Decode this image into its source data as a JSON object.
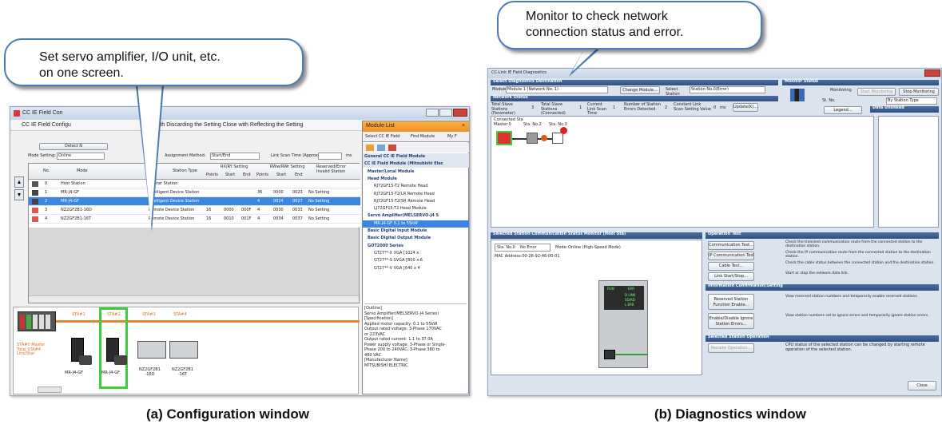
{
  "callouts": {
    "left": "Set servo amplifier, I/O unit, etc.\non one screen.",
    "right": "Monitor to check network\nconnection status and error."
  },
  "captions": {
    "a": "(a) Configuration window",
    "b": "(b) Diagnostics window"
  },
  "config_window": {
    "title": "CC IE Field Con",
    "menu": "CC IE Field Configu",
    "menu_rest": "e with Discarding the Setting   Close with Reflecting the Setting",
    "detect_button": "Detect N",
    "mode_setting_label": "Mode Setting:",
    "mode_setting_value": "Online",
    "assignment_method_label": "Assignment Method:",
    "assignment_method_value": "Start/End",
    "link_scan_label": "Link Scan Time (Approx.):",
    "link_scan_unit": "ms",
    "table_headers": [
      "No.",
      "Mode",
      "Station Type",
      "RX/RY Setting",
      "RWw/RWr Setting",
      "Reserved/Error Invalid Station"
    ],
    "subheaders": [
      "Points",
      "Start",
      "End",
      "Points",
      "Start",
      "End"
    ],
    "rows": [
      {
        "no": "0",
        "model": "Host Station",
        "type": "Master Station",
        "p1": "",
        "s1": "",
        "e1": "",
        "p2": "",
        "s2": "",
        "e2": "",
        "status": ""
      },
      {
        "no": "1",
        "model": "MR-J4-GF",
        "type": "Intelligent Device Station",
        "p1": "",
        "s1": "",
        "e1": "",
        "p2": "36",
        "s2": "0000",
        "e2": "0023",
        "status": "No Setting"
      },
      {
        "no": "2",
        "model": "MR-J4-GF",
        "type": "Intelligent Device Station",
        "p1": "",
        "s1": "",
        "e1": "",
        "p2": "4",
        "s2": "0024",
        "e2": "0027",
        "status": "No Setting"
      },
      {
        "no": "3",
        "model": "NZ2GF2B1-16D",
        "type": "Remote Device Station",
        "p1": "16",
        "s1": "0000",
        "e1": "000F",
        "p2": "4",
        "s2": "0030",
        "e2": "0033",
        "status": "No Setting"
      },
      {
        "no": "4",
        "model": "NZ2GF2B1-16T",
        "type": "Remote Device Station",
        "p1": "16",
        "s1": "0010",
        "e1": "001F",
        "p2": "4",
        "s2": "0034",
        "e2": "0037",
        "status": "No Setting"
      }
    ],
    "station_labels": [
      "STA#1",
      "STA#2",
      "STA#3",
      "STA#4"
    ],
    "master_label": "STA#0 Master\nTotal STA#4\nLine/Star",
    "device_labels": [
      "MR-J4-GF",
      "MR-J4-GF",
      "NZ2GF2B1\n-16D",
      "NZ2GF2B1\n-16T"
    ]
  },
  "module_list": {
    "title": "Module List",
    "tabs": [
      "Select CC IE Field",
      "Find Module",
      "My F"
    ],
    "items": [
      {
        "text": "General CC IE Field Module",
        "kind": "group"
      },
      {
        "text": "CC IE Field Module (Mitsubishi Elec",
        "kind": "group"
      },
      {
        "text": "Master/Local Module",
        "kind": "sub"
      },
      {
        "text": "Head Module",
        "kind": "sub"
      },
      {
        "text": "RJ72GF15-T2        Remote Head",
        "kind": "item"
      },
      {
        "text": "RJ72GF15-T2(LR Remote Head",
        "kind": "item"
      },
      {
        "text": "RJ72GF15-T2(SR Remote Head",
        "kind": "item"
      },
      {
        "text": "LJ72GF15-T2        Head Module",
        "kind": "item"
      },
      {
        "text": "Servo Amplifier(MELSERVO-J4 S",
        "kind": "sub"
      },
      {
        "text": "MR-J4-GF            0.1 to 55kW",
        "kind": "sel"
      },
      {
        "text": "Basic Digital Input Module",
        "kind": "sub"
      },
      {
        "text": "Basic Digital Output Module",
        "kind": "sub"
      },
      {
        "text": "GOT2000 Series",
        "kind": "sub"
      },
      {
        "text": "GT27**-X            XGA [1024 x",
        "kind": "item"
      },
      {
        "text": "GT27**-S            SVGA [800 x 6",
        "kind": "item"
      },
      {
        "text": "GT27**-V            VGA [640 x 4",
        "kind": "item"
      }
    ],
    "outline": "[Outline]\nServo Amplifier(MELSERVO-J4 Series)\n[Specification]\nApplied motor capacity: 0.1 to 55kW\nOutput rated voltage: 3-Phase 170VAC\nor 223VAC\nOutput rated current: 1.1 to 37.0A\nPower supply voltage: 3-Phase or Single-\nPhase 200 to 240VAC, 3-Phase 380 to\n480 VAC\n[Manufacturer Name]\nMITSUBISHI ELECTRIC"
  },
  "diag_window": {
    "title": "CC-Link IE Field Diagnostics",
    "select_dest": "Select Diagnostics Destination",
    "module_label": "Module",
    "module_value": "Module 1 (Network No. 1)",
    "change_module": "Change Module...",
    "select_station_label": "Select Station",
    "select_station_value": "Station No.0(Error)",
    "monitor_status": "Monitor Status",
    "monitoring": "Monitoring",
    "start_monitoring": "Start Monitoring",
    "stop_monitoring": "Stop Monitoring",
    "st_no": "St. No.",
    "by_station_type": "By Station Type",
    "network_status": "Network Status",
    "total_param": "Total Slave Stations (Parameter)",
    "total_param_val": "3",
    "total_conn": "Total Slave Stations (Connected)",
    "total_conn_val": "1",
    "current_scan": "Current Link Scan Time",
    "current_scan_val": "1",
    "num_errors": "Number of Station Errors Detected",
    "num_errors_val": "2",
    "constant_scan": "Constant Link Scan Setting Value",
    "constant_scan_val": "0",
    "ms": "ms",
    "update": "Update(K)...",
    "legend": "Legend...",
    "data_unlinked": "Data Unlinked",
    "connected_sta": "Connected Sta",
    "master": "Master:0",
    "sta2": "Sta. No.2",
    "sta3": "Sta. No.3",
    "sel_station_monitor": "Selected Station Communication Status Monitor (Host Sta)",
    "sta_no": "Sta. No.0",
    "no_error": "No Error",
    "mode_label": "Mode:",
    "mode_value": "Online (High-Speed Mode)",
    "mac": "MAC Address:00-26-92-46-00-01",
    "unit_leds": [
      "RUN",
      "ERR",
      "D LINK",
      "SD/RD",
      "L ERR"
    ],
    "operation_test": "Operation Test",
    "op_buttons": [
      "Communication Test...",
      "IP Communication Test...",
      "Cable Test...",
      "Link Start/Stop..."
    ],
    "op_desc": [
      "Check the transient communication route from the connected station to the destination station.",
      "Check the IP communication route from the connected station to the destination station.",
      "Check the cable status between the connected station and the destination station.",
      "Start or stop the network data link."
    ],
    "info_conf": "Information Confirmation/Setting",
    "info_buttons": [
      "Reserved Station Function Enable...",
      "Enable/Disable Ignore Station Errors..."
    ],
    "info_desc": [
      "View reserved station numbers and temporarily enable reserved stations.",
      "View station numbers set to ignore errors and temporarily ignore station errors."
    ],
    "sel_station_op": "Selected Station Operation",
    "remote_op": "Remote Operation...",
    "remote_desc": "CPU status of the selected station can be changed by starting remote operation of the selected station.",
    "close": "Close"
  }
}
